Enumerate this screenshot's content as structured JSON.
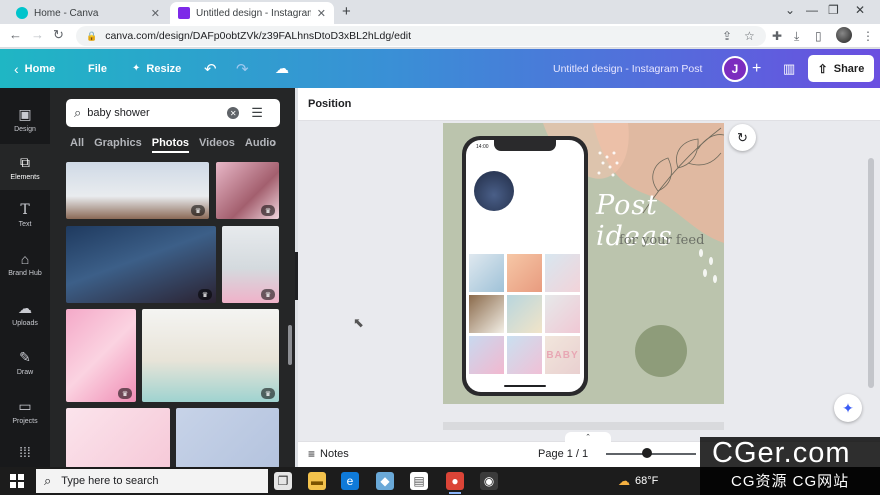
{
  "browser": {
    "tabs": [
      {
        "title": "Home - Canva",
        "close": "✕"
      },
      {
        "title": "Untitled design - Instagram Post",
        "close": "✕"
      }
    ],
    "new_tab": "+",
    "address": "canva.com/design/DAFp0obtZVk/z39FALhnsDtoD3xBL2hLdg/edit"
  },
  "canva_header": {
    "home_label": "Home",
    "file_label": "File",
    "resize_label": "Resize",
    "design_title": "Untitled design - Instagram Post",
    "avatar_initial": "J",
    "share_label": "Share"
  },
  "rail": {
    "items": [
      {
        "label": "Design",
        "icon": "design-icon"
      },
      {
        "label": "Elements",
        "icon": "elements-icon"
      },
      {
        "label": "Text",
        "icon": "text-icon"
      },
      {
        "label": "Brand Hub",
        "icon": "brand-hub-icon"
      },
      {
        "label": "Uploads",
        "icon": "uploads-icon"
      },
      {
        "label": "Draw",
        "icon": "draw-icon"
      },
      {
        "label": "Projects",
        "icon": "projects-icon"
      }
    ]
  },
  "panel": {
    "search_value": "baby shower",
    "tabs": [
      "All",
      "Graphics",
      "Photos",
      "Videos",
      "Audio"
    ],
    "active_tab": "Photos"
  },
  "editor": {
    "context_label": "Position"
  },
  "design": {
    "title": "Post ideas",
    "subtitle": "for your feed",
    "phone_time": "14:00",
    "grid_words": [
      "BABY"
    ]
  },
  "footer": {
    "notes_label": "Notes",
    "page_info": "Page 1 / 1",
    "zoom_fraction": 0.45
  },
  "taskbar": {
    "search_placeholder": "Type here to search",
    "weather": "68°F"
  },
  "watermark": {
    "top": "CGer.com",
    "bottom": "CG资源 CG网站"
  },
  "colors": {
    "header_start": "#1fb6c4",
    "header_end": "#6a4fe0",
    "avatar": "#7b2cbf",
    "panel_bg": "#252627",
    "rail_bg": "#18191b",
    "canvas_bg": "#bbc4ad"
  }
}
